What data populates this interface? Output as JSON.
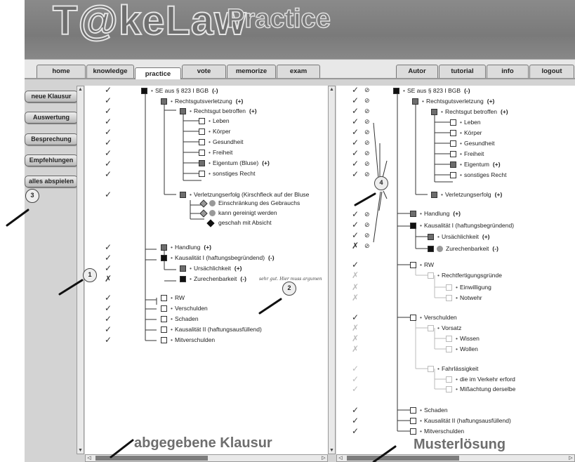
{
  "app": {
    "logo_main": "T@keLaw",
    "logo_sub": "Practice"
  },
  "nav": {
    "left_tabs": [
      "home",
      "knowledge",
      "practice",
      "vote",
      "memorize",
      "exam"
    ],
    "right_tabs": [
      "Autor",
      "tutorial",
      "info",
      "logout"
    ],
    "active": "practice"
  },
  "sidebar": {
    "buttons": [
      "neue Klausur",
      "Auswertung",
      "Besprechung",
      "Empfehlungen",
      "alles abspielen"
    ]
  },
  "left_panel": {
    "caption": "abgegebene Klausur",
    "comment": "sehr gut. Hier muss argumen",
    "rows": [
      {
        "label": "SE aus § 823 I BGB",
        "badge": "(-)"
      },
      {
        "label": "Rechtsgutsverletzung",
        "badge": "(+)"
      },
      {
        "label": "Rechtsgut betroffen",
        "badge": "(+)"
      },
      {
        "label": "Leben",
        "badge": ""
      },
      {
        "label": "Körper",
        "badge": ""
      },
      {
        "label": "Gesundheit",
        "badge": ""
      },
      {
        "label": "Freiheit",
        "badge": ""
      },
      {
        "label": "Eigentum  (Bluse)",
        "badge": "(+)"
      },
      {
        "label": "sonstiges Recht",
        "badge": ""
      },
      {
        "label": "Verletzungserfolg  (Kirschfleck auf der Bluse",
        "badge": ""
      },
      {
        "label": "Einschränkung des Gebrauchs",
        "badge": ""
      },
      {
        "label": "kann gereinigt werden",
        "badge": ""
      },
      {
        "label": "geschah mit Absicht",
        "badge": ""
      },
      {
        "label": "Handlung",
        "badge": "(+)"
      },
      {
        "label": "Kausalität I (haftungsbegründend)",
        "badge": "(-)"
      },
      {
        "label": "Ursächlichkeit",
        "badge": "(+)"
      },
      {
        "label": "Zurechenbarkeit",
        "badge": "(-)"
      },
      {
        "label": "RW",
        "badge": ""
      },
      {
        "label": "Verschulden",
        "badge": ""
      },
      {
        "label": "Schaden",
        "badge": ""
      },
      {
        "label": "Kausalität II (haftungsausfüllend)",
        "badge": ""
      },
      {
        "label": "Mitverschulden",
        "badge": ""
      }
    ]
  },
  "right_panel": {
    "caption": "Musterlösung",
    "rows": [
      {
        "label": "SE aus § 823 I BGB",
        "badge": "(-)"
      },
      {
        "label": "Rechtsgutsverletzung",
        "badge": "(+)"
      },
      {
        "label": "Rechtsgut betroffen",
        "badge": "(+)"
      },
      {
        "label": "Leben",
        "badge": ""
      },
      {
        "label": "Körper",
        "badge": ""
      },
      {
        "label": "Gesundheit",
        "badge": ""
      },
      {
        "label": "Freiheit",
        "badge": ""
      },
      {
        "label": "Eigentum",
        "badge": "(+)"
      },
      {
        "label": "sonstiges Recht",
        "badge": ""
      },
      {
        "label": "Verletzungserfolg",
        "badge": "(+)"
      },
      {
        "label": "Handlung",
        "badge": "(+)"
      },
      {
        "label": "Kausalität I (haftungsbegründend)",
        "badge": ""
      },
      {
        "label": "Ursächlichkeit",
        "badge": "(+)"
      },
      {
        "label": "Zurechenbarkeit",
        "badge": "(-)"
      },
      {
        "label": "RW",
        "badge": ""
      },
      {
        "label": "Rechtfertigungsgründe",
        "badge": ""
      },
      {
        "label": "Einwilligung",
        "badge": ""
      },
      {
        "label": "Notwehr",
        "badge": ""
      },
      {
        "label": "Verschulden",
        "badge": ""
      },
      {
        "label": "Vorsatz",
        "badge": ""
      },
      {
        "label": "Wissen",
        "badge": ""
      },
      {
        "label": "Wollen",
        "badge": ""
      },
      {
        "label": "Fahrlässigkeit",
        "badge": ""
      },
      {
        "label": "die im Verkehr erford",
        "badge": ""
      },
      {
        "label": "Mißachtung derselbe",
        "badge": ""
      },
      {
        "label": "Schaden",
        "badge": ""
      },
      {
        "label": "Kausalität II (haftungsausfüllend)",
        "badge": ""
      },
      {
        "label": "Mitverschulden",
        "badge": ""
      }
    ]
  },
  "markers": [
    "1",
    "2",
    "3",
    "4"
  ],
  "scroll_arrows": {
    "up": "▲",
    "down": "▼",
    "left": "◁",
    "right": "▷"
  },
  "icons": {
    "check": "✓",
    "cross": "✗",
    "bullet": "•",
    "target": "⊘"
  }
}
